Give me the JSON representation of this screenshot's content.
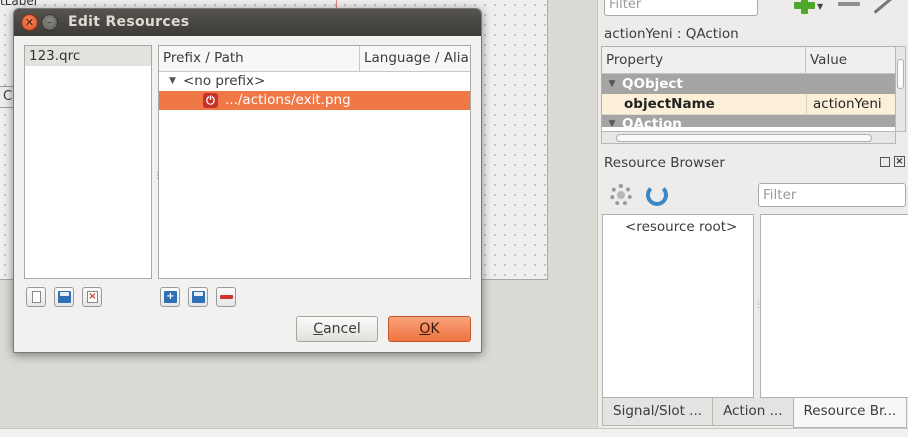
{
  "background": {
    "label_fragment": "tLabel",
    "widget_fragment": "C"
  },
  "property_editor": {
    "filter_placeholder": "Filter",
    "object_title": "actionYeni : QAction",
    "columns": [
      "Property",
      "Value"
    ],
    "group_qobject": "QObject",
    "property_name": "objectName",
    "property_value": "actionYeni",
    "group_qaction": "QAction"
  },
  "resource_browser": {
    "title": "Resource Browser",
    "filter_placeholder": "Filter",
    "root_item": "<resource root>",
    "float_icon": "float-icon",
    "close_icon": "close-icon"
  },
  "dock_tabs": [
    {
      "label": "Signal/Slot ..."
    },
    {
      "label": "Action ..."
    },
    {
      "label": "Resource Br..."
    }
  ],
  "dialog": {
    "title": "Edit Resources",
    "close_glyph": "✕",
    "minimize_glyph": "–",
    "files": [
      "123.qrc"
    ],
    "columns": [
      "Prefix / Path",
      "Language / Alia"
    ],
    "prefix_item": "<no prefix>",
    "file_item": ".../actions/exit.png",
    "cancel_mnemonic": "C",
    "cancel_rest": "ancel",
    "ok_mnemonic": "O",
    "ok_rest": "K",
    "accent": "#f07746"
  }
}
